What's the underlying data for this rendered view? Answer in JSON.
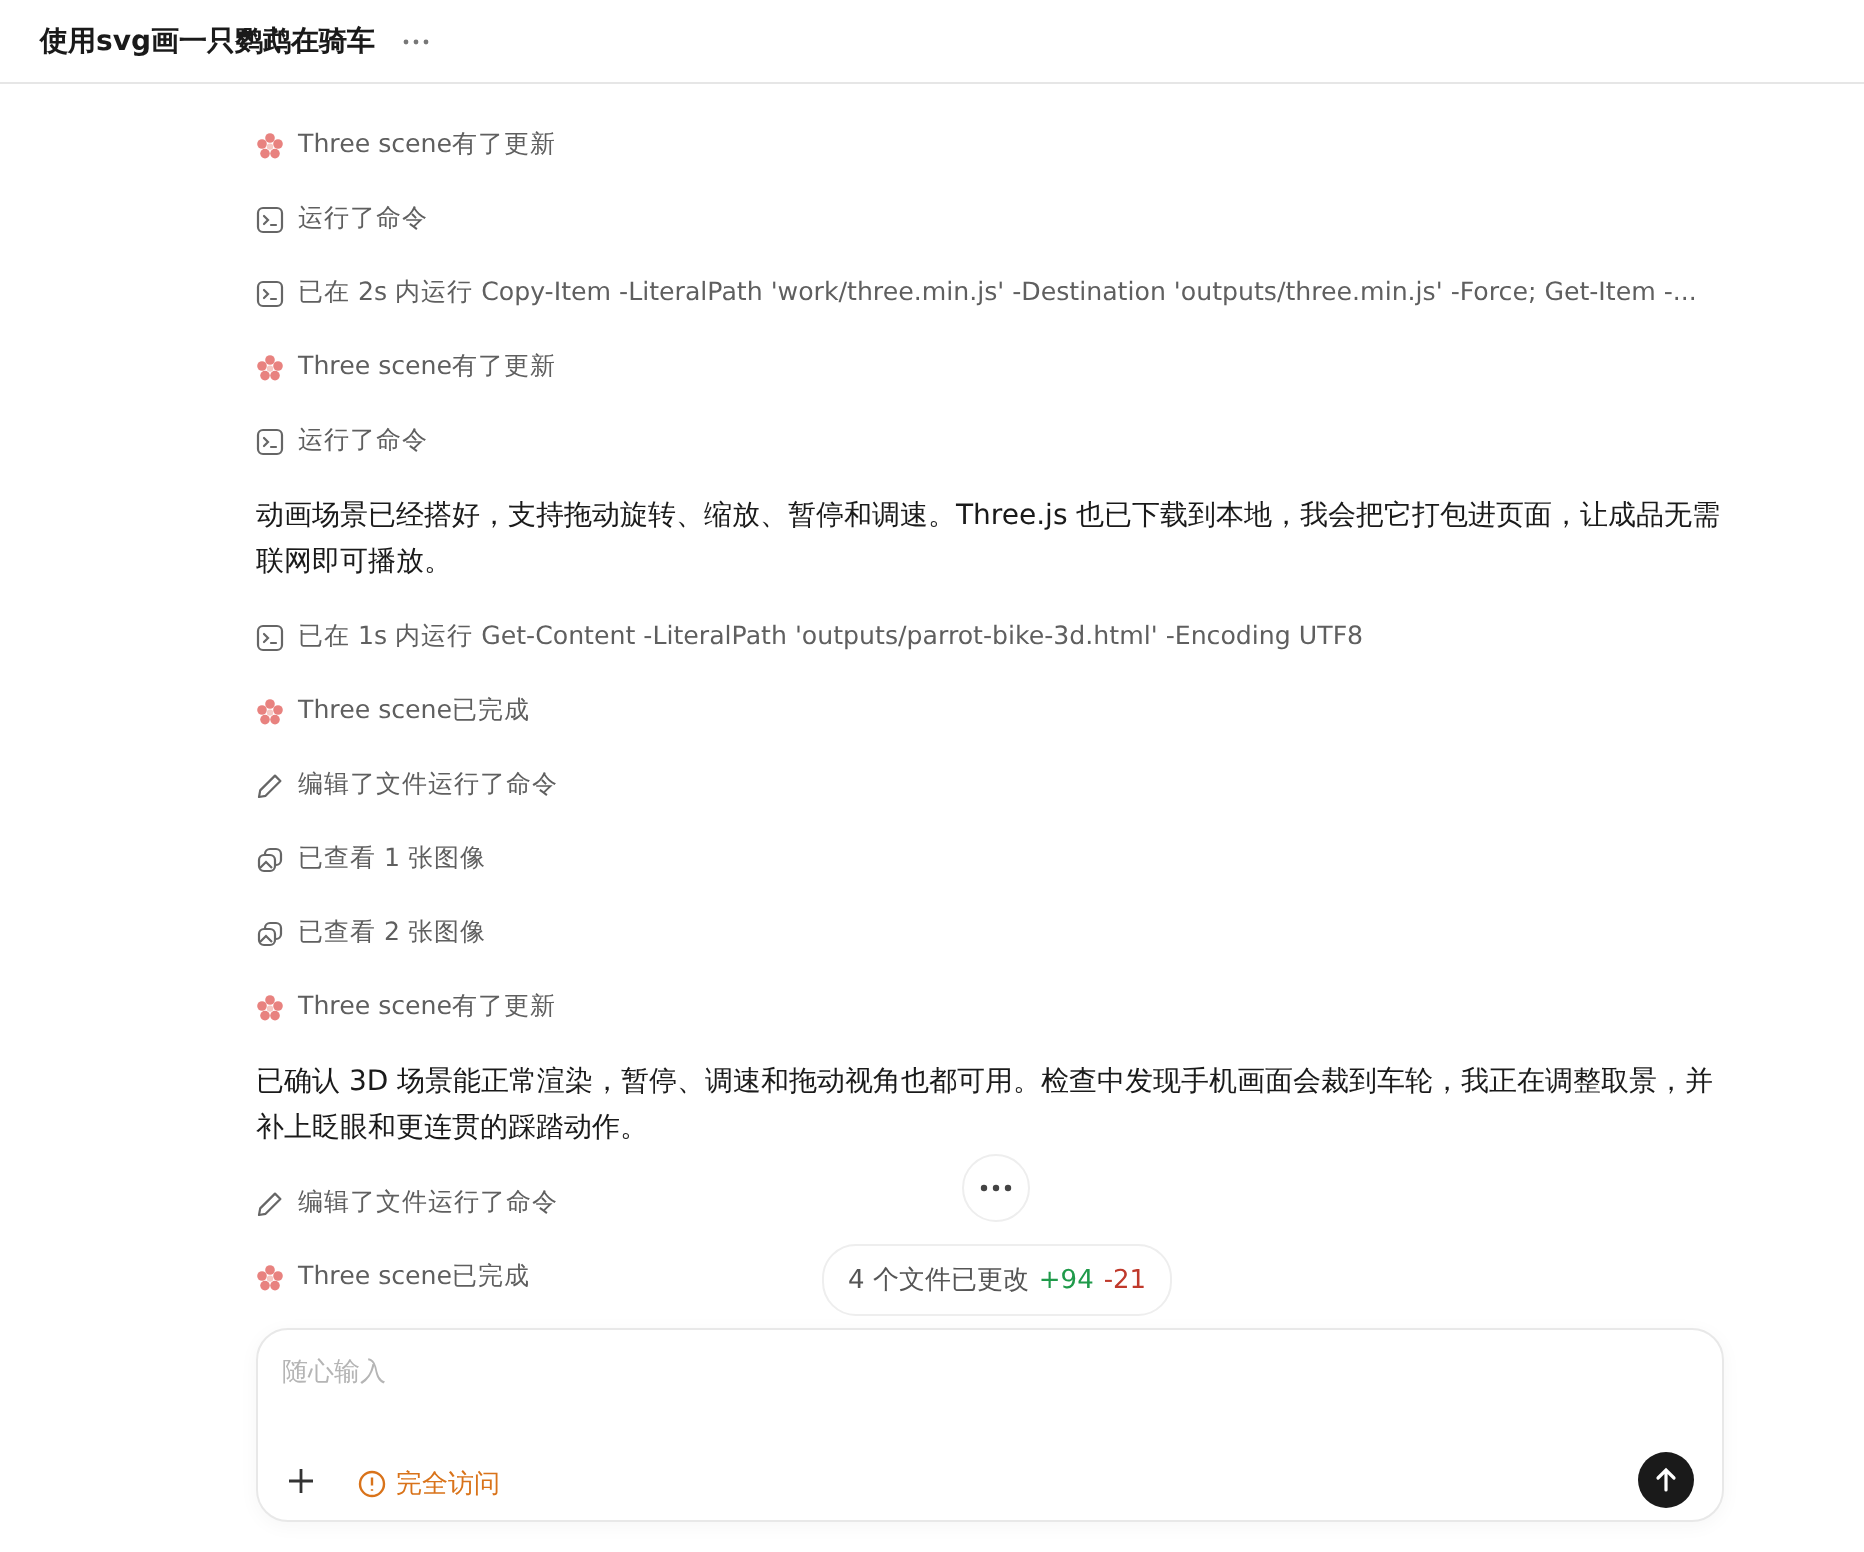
{
  "header": {
    "title": "使用svg画一只鹦鹉在骑车"
  },
  "log": [
    {
      "kind": "scene",
      "text": "Three scene有了更新"
    },
    {
      "kind": "terminal",
      "text": "运行了命令"
    },
    {
      "kind": "terminal",
      "text": "已在 2s 内运行 Copy-Item -LiteralPath 'work/three.min.js' -Destination 'outputs/three.min.js' -Force; Get-Item -..."
    },
    {
      "kind": "scene",
      "text": "Three scene有了更新"
    },
    {
      "kind": "terminal",
      "text": "运行了命令"
    },
    {
      "kind": "message",
      "text": "动画场景已经搭好，支持拖动旋转、缩放、暂停和调速。Three.js 也已下载到本地，我会把它打包进页面，让成品无需联网即可播放。"
    },
    {
      "kind": "terminal",
      "text": "已在 1s 内运行 Get-Content -LiteralPath 'outputs/parrot-bike-3d.html' -Encoding UTF8"
    },
    {
      "kind": "scene",
      "text": "Three scene已完成"
    },
    {
      "kind": "edit",
      "text": "编辑了文件运行了命令"
    },
    {
      "kind": "images",
      "text": "已查看 1 张图像"
    },
    {
      "kind": "images",
      "text": "已查看 2 张图像"
    },
    {
      "kind": "scene",
      "text": "Three scene有了更新"
    },
    {
      "kind": "message",
      "text": "已确认 3D 场景能正常渲染，暂停、调速和拖动视角也都可用。检查中发现手机画面会裁到车轮，我正在调整取景，并补上眨眼和更连贯的踩踏动作。"
    },
    {
      "kind": "edit",
      "text": "编辑了文件运行了命令"
    },
    {
      "kind": "scene",
      "text": "Three scene已完成"
    }
  ],
  "changes": {
    "text": "4 个文件已更改",
    "added": "+94",
    "removed": "-21"
  },
  "composer": {
    "placeholder": "随心输入",
    "access": "完全访问"
  }
}
